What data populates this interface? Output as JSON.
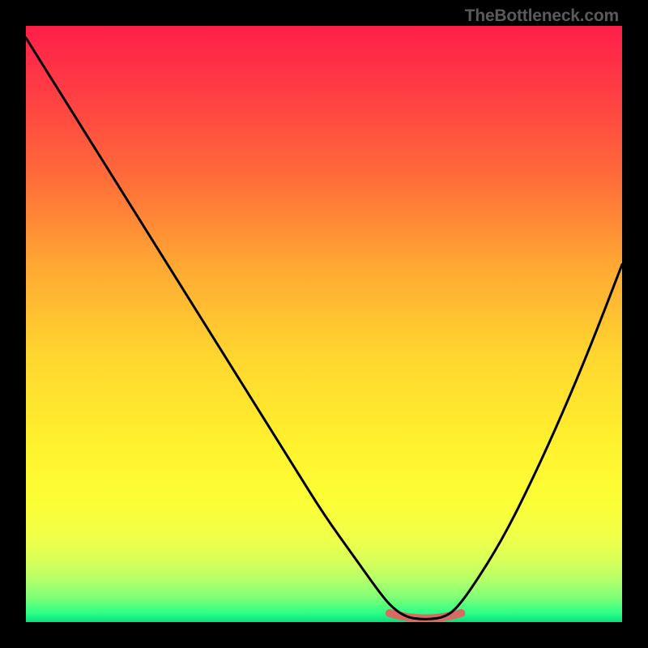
{
  "watermark": "TheBottleneck.com",
  "colors": {
    "black": "#000000",
    "curve_black": "#000000",
    "marker": "#d86a63",
    "gradient_stops": [
      {
        "offset": 0.0,
        "color": "#ff1f49"
      },
      {
        "offset": 0.1,
        "color": "#ff3a45"
      },
      {
        "offset": 0.25,
        "color": "#ff6a3a"
      },
      {
        "offset": 0.4,
        "color": "#ffa733"
      },
      {
        "offset": 0.55,
        "color": "#ffd52f"
      },
      {
        "offset": 0.7,
        "color": "#fff12e"
      },
      {
        "offset": 0.8,
        "color": "#fbff36"
      },
      {
        "offset": 0.86,
        "color": "#efff4a"
      },
      {
        "offset": 0.9,
        "color": "#d6ff5b"
      },
      {
        "offset": 0.93,
        "color": "#b2ff6a"
      },
      {
        "offset": 0.96,
        "color": "#7cff78"
      },
      {
        "offset": 0.985,
        "color": "#2bff87"
      },
      {
        "offset": 1.0,
        "color": "#07df7a"
      }
    ]
  },
  "chart_data": {
    "type": "line",
    "title": "",
    "xlabel": "",
    "ylabel": "",
    "xlim": [
      0,
      100
    ],
    "ylim": [
      0,
      100
    ],
    "grid": false,
    "legend": false,
    "series": [
      {
        "name": "bottleneck-curve",
        "x": [
          0,
          5,
          10,
          15,
          20,
          25,
          30,
          35,
          40,
          45,
          50,
          55,
          60,
          62,
          64,
          66,
          68,
          70,
          72,
          75,
          80,
          85,
          90,
          95,
          100
        ],
        "values": [
          98,
          90,
          82,
          74,
          66,
          58,
          50,
          42,
          34,
          26,
          18,
          11,
          4,
          2,
          0.8,
          0.5,
          0.5,
          0.8,
          2,
          6,
          14,
          24,
          35,
          47,
          60
        ]
      }
    ],
    "marker_region": {
      "x_start": 61,
      "x_end": 73,
      "y": 0.6
    },
    "annotations": []
  }
}
